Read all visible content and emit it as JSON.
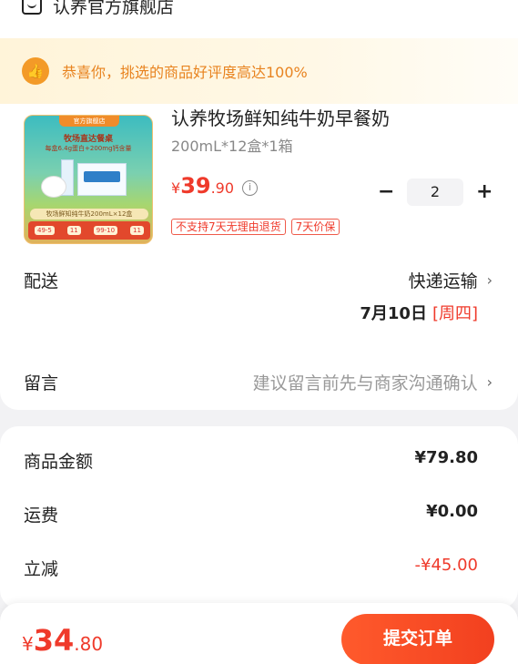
{
  "store": {
    "name": "认养官方旗舰店",
    "icon": "shop-icon"
  },
  "banner": {
    "text": "恭喜你，挑选的商品好评度高达100%",
    "icon": "thumbs-up-icon",
    "color": "#e8831f"
  },
  "product": {
    "title": "认养牧场鲜知纯牛奶早餐奶",
    "spec": "200mL*12盒*1箱",
    "price_symbol": "¥",
    "price_int": "39",
    "price_dec": ".90",
    "quantity": "2",
    "minus": "−",
    "plus": "+",
    "tags": [
      "不支持7天无理由退货",
      "7天价保"
    ],
    "image": {
      "badge": "官方旗舰店",
      "title": "牧场直达餐桌",
      "subtitle": "每盒6.4g蛋白+200mg钙含量",
      "strip": "牧场鲜知纯牛奶200mL×12盒",
      "promo": [
        "49-5",
        "11",
        "99-10",
        "11"
      ]
    }
  },
  "delivery": {
    "label": "配送",
    "method": "快递运输",
    "date": "7月10日",
    "weekday": "[周四]"
  },
  "message": {
    "label": "留言",
    "placeholder": "建议留言前先与商家沟通确认"
  },
  "summary": {
    "goods_label": "商品金额",
    "goods_value": "¥79.80",
    "shipping_label": "运费",
    "shipping_value": "¥0.00",
    "discount_label": "立减",
    "discount_value": "-¥45.00"
  },
  "footer": {
    "symbol": "¥",
    "total_int": "34",
    "total_dec": ".80",
    "submit_label": "提交订单"
  },
  "colors": {
    "accent": "#ef3a2b",
    "button": "#f2401f",
    "banner_bg": "#fff4d9"
  }
}
